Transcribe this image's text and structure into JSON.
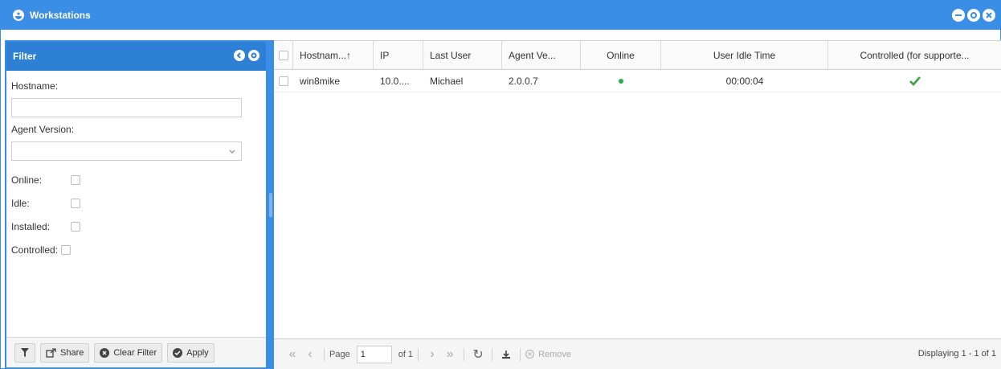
{
  "window": {
    "title": "Workstations"
  },
  "filter": {
    "title": "Filter",
    "hostname_label": "Hostname:",
    "hostname_value": "",
    "agent_version_label": "Agent Version:",
    "agent_version_value": "",
    "checks": {
      "online": "Online:",
      "idle": "Idle:",
      "installed": "Installed:",
      "controlled": "Controlled:"
    },
    "buttons": {
      "share": "Share",
      "clear": "Clear Filter",
      "apply": "Apply"
    }
  },
  "grid": {
    "columns": {
      "hostname": "Hostnam...↑",
      "ip": "IP",
      "last_user": "Last User",
      "agent_version": "Agent Ve...",
      "online": "Online",
      "idle_time": "User Idle Time",
      "controlled": "Controlled (for supporte..."
    },
    "rows": [
      {
        "hostname": "win8mike",
        "ip": "10.0....",
        "last_user": "Michael",
        "agent_version": "2.0.0.7",
        "online": true,
        "idle_time": "00:00:04",
        "controlled": true
      }
    ]
  },
  "pager": {
    "page_label": "Page",
    "page_value": "1",
    "of_label": "of 1",
    "remove_label": "Remove",
    "display_text": "Displaying 1 - 1 of 1"
  },
  "colors": {
    "accent": "#3a8ee6",
    "online_dot": "#2fa84f",
    "check_green": "#3aa53a"
  }
}
